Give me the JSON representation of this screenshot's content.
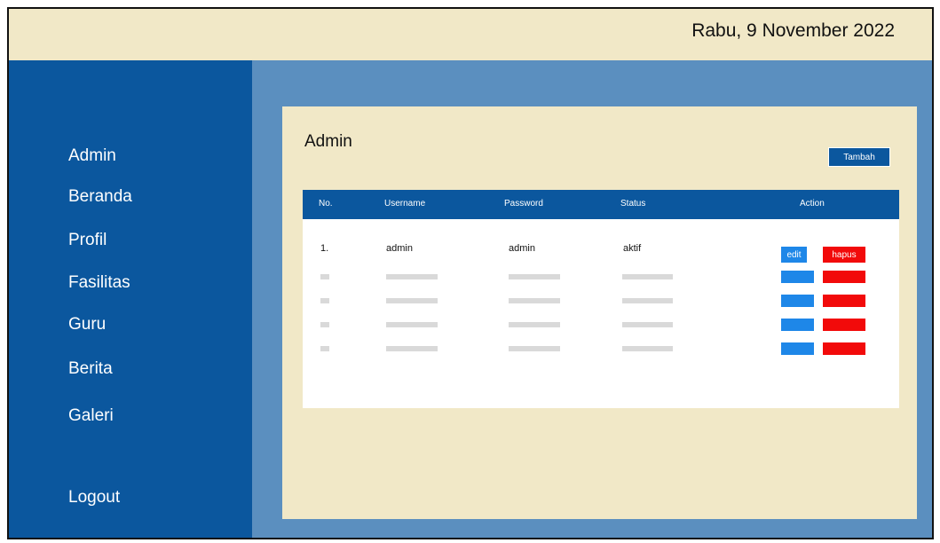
{
  "header": {
    "date": "Rabu, 9 November 2022"
  },
  "sidebar": {
    "items": [
      {
        "label": "Admin"
      },
      {
        "label": "Beranda"
      },
      {
        "label": "Profil"
      },
      {
        "label": "Fasilitas"
      },
      {
        "label": "Guru"
      },
      {
        "label": "Berita"
      },
      {
        "label": "Galeri"
      }
    ],
    "logout": "Logout"
  },
  "main": {
    "title": "Admin",
    "add_button": "Tambah",
    "table": {
      "headers": [
        "No.",
        "Username",
        "Password",
        "Status",
        "Action"
      ],
      "rows": [
        {
          "no": "1.",
          "username": "admin",
          "password": "admin",
          "status": "aktif",
          "edit": "edit",
          "delete": "hapus"
        }
      ],
      "placeholder_rows": 4
    }
  },
  "colors": {
    "topbar": "#f1e8c7",
    "sidebar": "#0b579e",
    "main_bg": "#5b8fbf",
    "panel": "#f1e8c7",
    "edit": "#1e87e8",
    "delete": "#f20a0a",
    "placeholder": "#d9d9d9"
  }
}
